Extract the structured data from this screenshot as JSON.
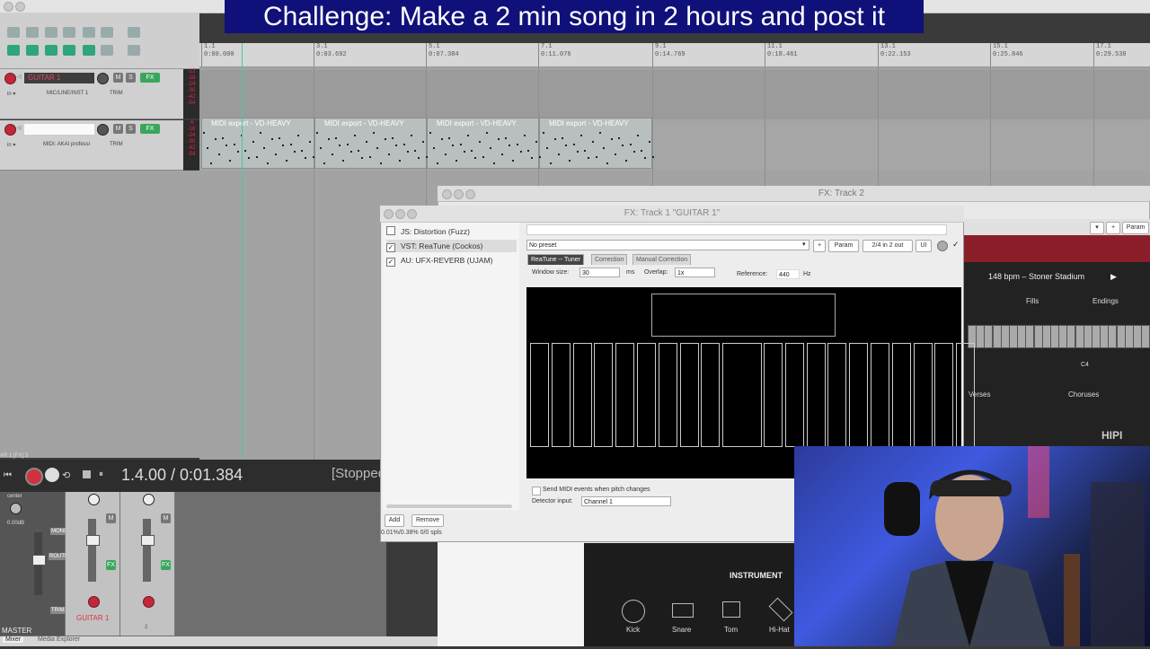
{
  "banner": {
    "text": "Challenge: Make a 2 min song in 2 hours and post it"
  },
  "ruler": {
    "marks": [
      {
        "bar": "1.1",
        "time": "0:00.000"
      },
      {
        "bar": "3.1",
        "time": "0:03.692"
      },
      {
        "bar": "5.1",
        "time": "0:07.384"
      },
      {
        "bar": "7.1",
        "time": "0:11.076"
      },
      {
        "bar": "9.1",
        "time": "0:14.769"
      },
      {
        "bar": "11.1",
        "time": "0:18.461"
      },
      {
        "bar": "13.1",
        "time": "0:22.153"
      },
      {
        "bar": "15.1",
        "time": "0:25.846"
      },
      {
        "bar": "17.1",
        "time": "0:29.538"
      }
    ]
  },
  "tracks": [
    {
      "name": "GUITAR 1",
      "input": "MIC/LINE/INST 1",
      "trim": "TRIM",
      "m": "M",
      "s": "S",
      "fx": "FX"
    },
    {
      "name": "",
      "input": "MIDI: AKAI professi",
      "trim": "TRIM",
      "m": "M",
      "s": "S",
      "fx": "FX"
    }
  ],
  "midi_items": [
    {
      "label": "MIDI export - VD-HEAVY"
    },
    {
      "label": "MIDI export - VD-HEAVY"
    },
    {
      "label": "MIDI export - VD-HEAVY"
    },
    {
      "label": "MIDI export - VD-HEAVY"
    }
  ],
  "transport": {
    "position": "1.4.00 / 0:01.384",
    "state": "[Stopped"
  },
  "fx_track_label": "AR 1 [FX] 3",
  "mixer": {
    "master_label": "MASTER",
    "center": "center",
    "volume": "0.00dB",
    "track_label": "GUITAR 1",
    "mono": "MONO",
    "route": "ROUTE",
    "trim": "TRIM",
    "track_number": "2"
  },
  "bottom_tabs": {
    "mixer": "Mixer",
    "media_explorer": "Media Explorer"
  },
  "fx2": {
    "title": "FX: Track 2",
    "param": "Param",
    "bpm": "148 bpm – Stoner Stadium",
    "fills": "Fills",
    "endings": "Endings",
    "verses": "Verses",
    "choruses": "Choruses",
    "key": "C4",
    "logo": "HIPI",
    "instrument": "INSTRUMENT",
    "pads": [
      "Kick",
      "Snare",
      "Tom",
      "Hi-Hat"
    ]
  },
  "fx1": {
    "title": "FX: Track 1 \"GUITAR 1\"",
    "plugins": [
      {
        "name": "JS: Distortion (Fuzz)",
        "checked": false
      },
      {
        "name": "VST: ReaTune (Cockos)",
        "checked": true
      },
      {
        "name": "AU: UFX-REVERB (UJAM)",
        "checked": true
      }
    ],
    "preset": "No preset",
    "plus": "+",
    "param": "Param",
    "io": "2/4 in 2 out",
    "ui": "UI",
    "tabs": [
      "ReaTune -- Tuner",
      "Correction",
      "Manual Correction"
    ],
    "window_size_label": "Window size:",
    "window_size": "30",
    "ms": "ms",
    "overlap_label": "Overlap:",
    "overlap": "1x",
    "reference_label": "Reference:",
    "reference": "440",
    "hz": "Hz",
    "send_midi": "Send MIDI events when pitch changes",
    "detector_label": "Detector input:",
    "detector": "Channel 1",
    "add": "Add",
    "remove": "Remove",
    "status": "0.01%/0.38% 0/0 spls"
  }
}
